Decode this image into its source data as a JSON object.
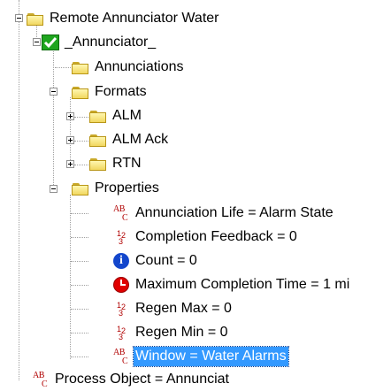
{
  "tree": {
    "root_label": "Remote Annunciator Water",
    "annunciator_label": "_Annunciator_",
    "annunciations_label": "Annunciations",
    "formats_label": "Formats",
    "formats_children": [
      "ALM",
      "ALM Ack",
      "RTN"
    ],
    "properties_label": "Properties",
    "properties": [
      {
        "icon": "ab-text-icon",
        "text": "Annunciation Life = Alarm State"
      },
      {
        "icon": "numeric-icon",
        "text": "Completion Feedback = 0"
      },
      {
        "icon": "info-icon",
        "text": "Count = 0"
      },
      {
        "icon": "clock-icon",
        "text": "Maximum Completion Time = 1 mi"
      },
      {
        "icon": "numeric-icon",
        "text": "Regen Max = 0"
      },
      {
        "icon": "numeric-icon",
        "text": "Regen Min = 0"
      },
      {
        "icon": "ab-text-icon",
        "text": "Window = Water Alarms"
      }
    ],
    "cut_off_label": "Process Object = Annunciat",
    "selected_index": 6
  },
  "colors": {
    "selection": "#3399ff",
    "folder": "#f1d760",
    "check": "#1fa51f",
    "ab_text": "#b00000",
    "info": "#1346cc",
    "clock": "#e00000"
  }
}
